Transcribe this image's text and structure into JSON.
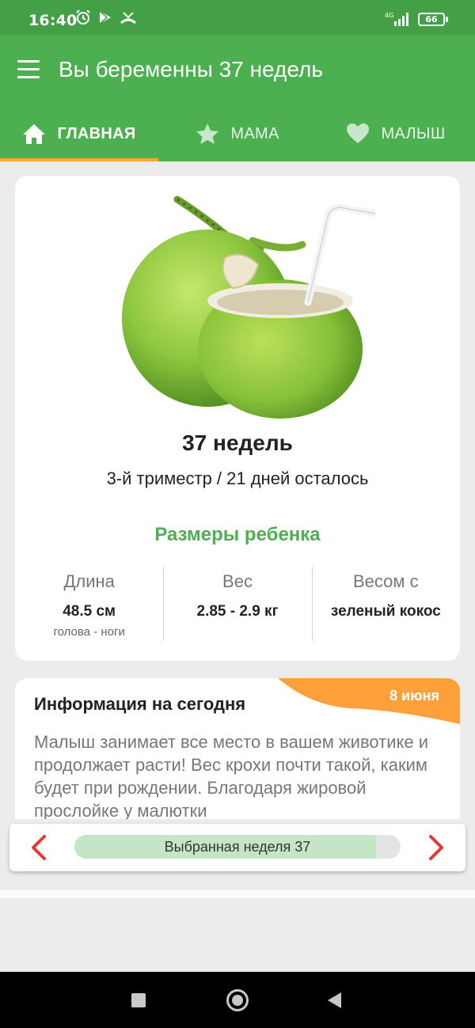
{
  "status_bar": {
    "time": "16:40",
    "battery": "66",
    "network": "4G"
  },
  "app_bar": {
    "title": "Вы беременны 37 недель"
  },
  "tabs": [
    {
      "label": "ГЛАВНАЯ",
      "icon": "home-icon",
      "active": true
    },
    {
      "label": "МАМА",
      "icon": "star-icon",
      "active": false
    },
    {
      "label": "МАЛЫШ",
      "icon": "heart-icon",
      "active": false
    }
  ],
  "main_card": {
    "week_title": "37 недель",
    "trimester_line": "3-й триместр / 21 дней осталось",
    "sizes_heading": "Размеры ребенка",
    "stats": [
      {
        "label": "Длина",
        "value": "48.5 см",
        "sub": "голова - ноги"
      },
      {
        "label": "Вес",
        "value": "2.85 - 2.9 кг",
        "sub": ""
      },
      {
        "label": "Весом с",
        "value": "зеленый кокос",
        "sub": ""
      }
    ]
  },
  "info_card": {
    "title": "Информация на сегодня",
    "date": "8 июня",
    "text": "Малыш занимает все место в вашем животике и продолжает расти! Вес крохи почти такой, каким будет при рождении. Благодаря жировой прослойке у малютки"
  },
  "week_selector": {
    "label": "Выбранная неделя 37",
    "progress": 0.925
  },
  "colors": {
    "primary": "#4caf50",
    "status_bar": "#43a047",
    "accent": "#ffa726",
    "arrow": "#e53935"
  }
}
